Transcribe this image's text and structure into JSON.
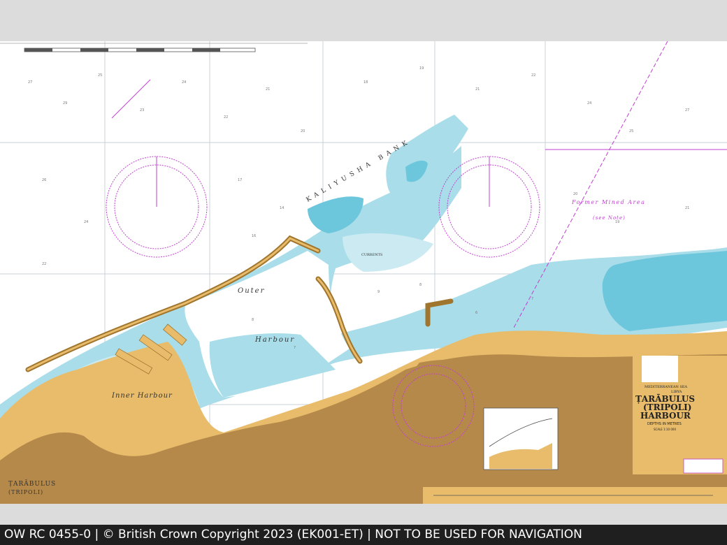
{
  "footer": {
    "text": "OW RC 0455-0 | © British Crown Copyright 2023 (EK001-ET) | NOT TO BE USED FOR NAVIGATION"
  },
  "chart": {
    "labels": {
      "bank": "KALIYUSHA BANK",
      "outer": "Outer",
      "harbour_word": "Harbour",
      "inner_harbour": "Inner Harbour",
      "former_mined": "Former Mined Area",
      "see_note": "(see Note)",
      "currents": "CURRENTS",
      "town_line1": "ṬARĀBULUS",
      "town_line2": "(TRIPOLI)"
    },
    "title_block": {
      "sea": "MEDITERRANEAN SEA",
      "country": "LIBYA",
      "title1": "ṬARĀBULUS",
      "title2": "(TRIPOLI)",
      "title3": "HARBOUR",
      "depths": "DEPTHS IN METRES",
      "scale": "SCALE 1:10 000"
    },
    "colors": {
      "land_dark": "#b5894a",
      "land_light": "#e8bc6a",
      "shallow": "#a8dde9",
      "shallower": "#6cc6dc",
      "deep": "#ffffff",
      "compass": "#c040d0",
      "grid": "#9aa6b0"
    }
  }
}
